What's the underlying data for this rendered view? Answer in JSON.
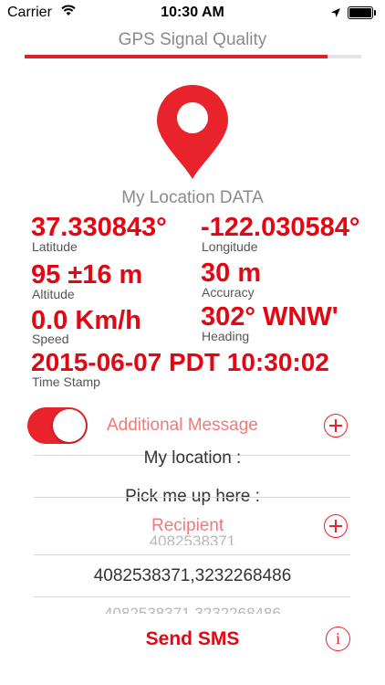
{
  "status_bar": {
    "carrier": "Carrier",
    "time": "10:30 AM",
    "battery_level": 1.0
  },
  "header": {
    "title": "GPS Signal Quality",
    "signal_quality": 0.9
  },
  "location": {
    "title": "My Location DATA",
    "latitude": {
      "value": "37.330843°",
      "label": "Latitude"
    },
    "longitude": {
      "value": "-122.030584°",
      "label": "Longitude"
    },
    "altitude": {
      "value": "95 ±16 m",
      "label": "Altitude"
    },
    "accuracy": {
      "value": "30 m",
      "label": "Accuracy"
    },
    "speed": {
      "value": "0.0 Km/h",
      "label": "Speed"
    },
    "heading": {
      "value": "302° WNW'",
      "label": "Heading"
    },
    "timestamp": {
      "value": "2015-06-07 PDT 10:30:02",
      "label": "Time Stamp"
    }
  },
  "message": {
    "toggle_on": true,
    "label": "Additional Message",
    "picker_items": [
      "My location :",
      "Pick me up here :"
    ]
  },
  "recipient": {
    "label": "Recipient",
    "picker_above": "4082538371",
    "selected": "4082538371,3232268486",
    "picker_below": "4082538371,3232268486"
  },
  "actions": {
    "send_label": "Send SMS",
    "info_label": "i"
  },
  "colors": {
    "accent": "#e30613",
    "muted": "#8a8a8a",
    "pink_label": "#f07a7a"
  }
}
